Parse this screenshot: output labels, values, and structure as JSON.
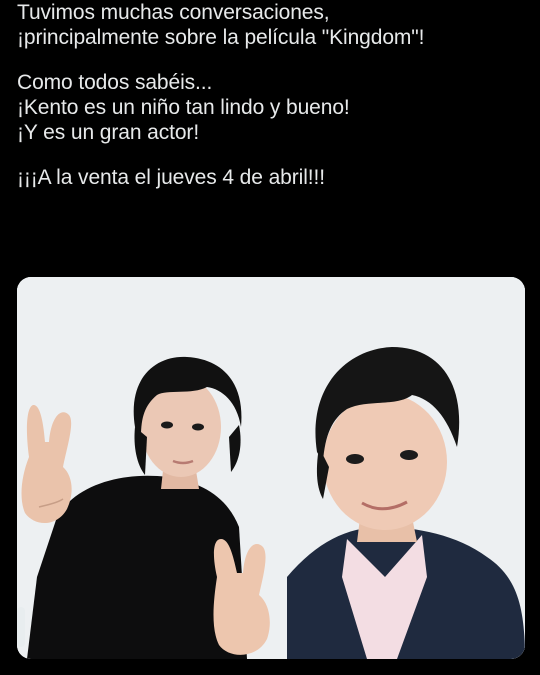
{
  "tweet": {
    "lines": [
      "Tuvimos muchas conversaciones,",
      "¡principalmente sobre la película \"Kingdom\"!",
      "Como todos sabéis...",
      "¡Kento es un niño tan lindo y bueno!",
      "¡Y es un gran actor!",
      "¡¡¡A la venta el jueves 4 de abril!!!"
    ]
  },
  "media": {
    "type": "photo",
    "background_color": "#e9eef0"
  }
}
